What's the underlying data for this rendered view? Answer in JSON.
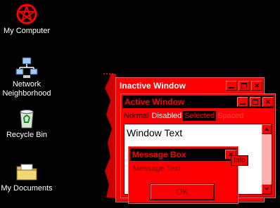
{
  "desktop": {
    "background": "#000000",
    "icons": [
      {
        "label": "My Computer",
        "icon": "pentagram-icon"
      },
      {
        "label": "Network Neighborhood",
        "icon": "network-icon"
      },
      {
        "label": "Recycle Bin",
        "icon": "recycle-bin-icon"
      },
      {
        "label": "My Documents",
        "icon": "folder-icon"
      }
    ]
  },
  "inactive_window": {
    "title": "Inactive Window",
    "controls": [
      "minimize",
      "maximize",
      "close"
    ]
  },
  "active_window": {
    "title": "Active Window",
    "menu": {
      "normal": "Normal",
      "disabled": "Disabled",
      "selected": "Selected",
      "spaced": "Spaced"
    },
    "content_text": "Window Text"
  },
  "message_box": {
    "title": "Message Box",
    "text": "Message Text",
    "ok_label": "OK",
    "close_tooltip": "Info"
  },
  "colors": {
    "accent": "#ff0000",
    "title_active_bg": "#000000",
    "window_bg": "#ffffff"
  }
}
